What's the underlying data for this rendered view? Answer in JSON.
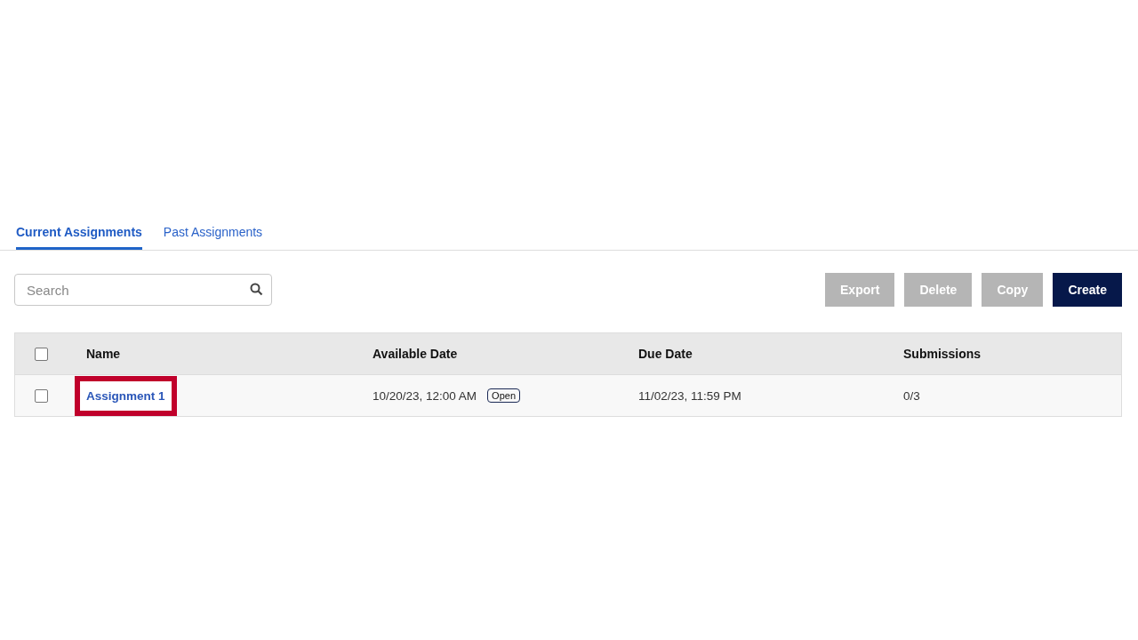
{
  "tabs": [
    {
      "label": "Current Assignments",
      "selected": true
    },
    {
      "label": "Past Assignments",
      "selected": false
    }
  ],
  "search": {
    "placeholder": "Search"
  },
  "buttons": [
    {
      "label": "Export",
      "disabled": true
    },
    {
      "label": "Delete",
      "disabled": true
    },
    {
      "label": "Copy",
      "disabled": true
    },
    {
      "label": "Create",
      "disabled": false
    }
  ],
  "table": {
    "header_checked": false,
    "columns": [
      "Name",
      "Available Date",
      "Due Date",
      "Submissions"
    ],
    "rows": [
      {
        "checked": false,
        "name": "Assignment 1",
        "highlighted": true,
        "available_date": "10/20/23, 12:00 AM",
        "status": "Open",
        "due_date": "11/02/23, 11:59 PM",
        "submissions": "0/3"
      }
    ]
  }
}
